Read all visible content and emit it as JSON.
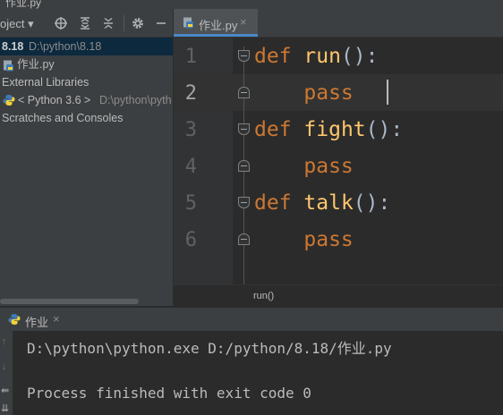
{
  "window": {
    "title": "作业.py"
  },
  "project_toolbar": {
    "label": "oject"
  },
  "tree": {
    "items": [
      {
        "name": "8.18",
        "path": "D:\\python\\8.18"
      },
      {
        "name": "作业.py"
      },
      {
        "name": "External Libraries"
      },
      {
        "name": "< Python 3.6 >",
        "path": "D:\\python\\pyth"
      },
      {
        "name": "Scratches and Consoles"
      }
    ]
  },
  "editor": {
    "tab": {
      "label": "作业.py"
    },
    "line_numbers": [
      "1",
      "2",
      "3",
      "4",
      "5",
      "6"
    ],
    "lines": [
      {
        "kw": "def",
        "name": "run",
        "tail": "():"
      },
      {
        "body": "pass"
      },
      {
        "kw": "def",
        "name": "fight",
        "tail": "():"
      },
      {
        "body": "pass"
      },
      {
        "kw": "def",
        "name": "talk",
        "tail": "():"
      },
      {
        "body": "pass"
      }
    ],
    "breadcrumb": "run()"
  },
  "run_panel": {
    "tab_label": "作业",
    "output": [
      "D:\\python\\python.exe D:/python/8.18/作业.py",
      "",
      "Process finished with exit code 0"
    ]
  },
  "colors": {
    "keyword": "#cc7832",
    "function": "#ffc66d",
    "selection": "#0d293e",
    "tab_underline": "#4a88c7"
  }
}
